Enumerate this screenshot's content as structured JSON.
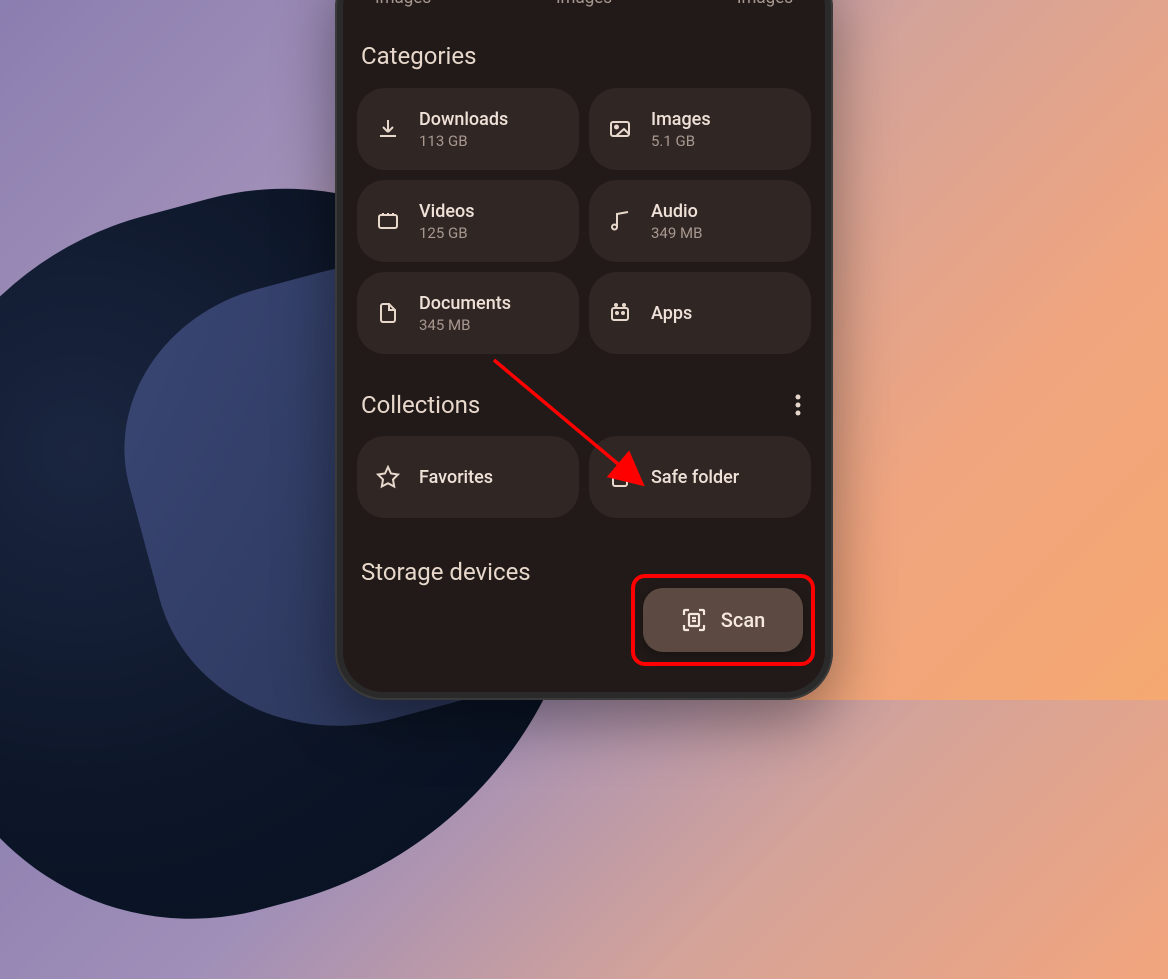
{
  "topLabels": [
    "Images",
    "Images",
    "Images"
  ],
  "sections": {
    "categories": "Categories",
    "collections": "Collections",
    "storage": "Storage devices"
  },
  "categories": {
    "downloads": {
      "label": "Downloads",
      "size": "113 GB"
    },
    "images": {
      "label": "Images",
      "size": "5.1 GB"
    },
    "videos": {
      "label": "Videos",
      "size": "125 GB"
    },
    "audio": {
      "label": "Audio",
      "size": "349 MB"
    },
    "documents": {
      "label": "Documents",
      "size": "345 MB"
    },
    "apps": {
      "label": "Apps"
    }
  },
  "collections": {
    "favorites": {
      "label": "Favorites"
    },
    "safeFolder": {
      "label": "Safe folder"
    }
  },
  "scan": {
    "label": "Scan"
  }
}
